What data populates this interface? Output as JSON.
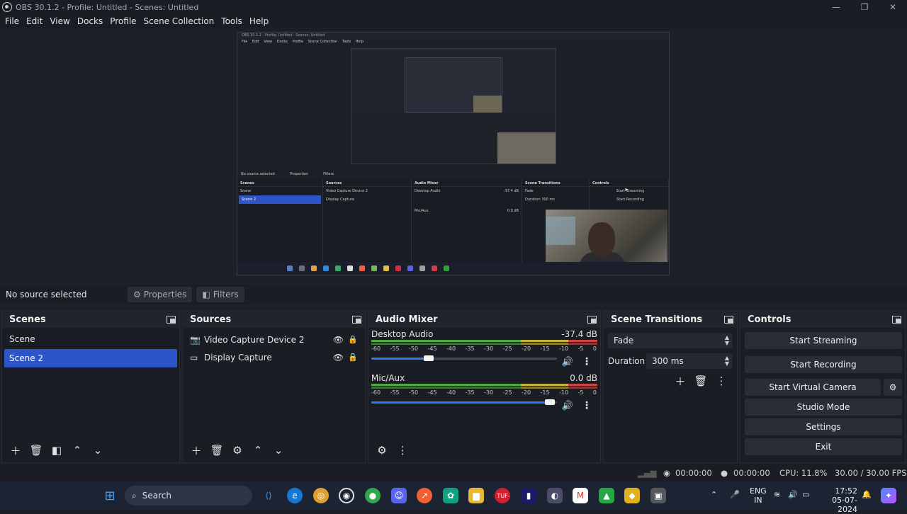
{
  "window": {
    "title": "OBS 30.1.2 - Profile: Untitled - Scenes: Untitled",
    "minimize": "—",
    "maximize": "❐",
    "close": "✕"
  },
  "menu": [
    "File",
    "Edit",
    "View",
    "Docks",
    "Profile",
    "Scene Collection",
    "Tools",
    "Help"
  ],
  "preview": {
    "mini_title": "OBS 30.1.2 - Profile: Untitled - Scenes: Untitled",
    "mini_menu": [
      "File",
      "Edit",
      "View",
      "Docks",
      "Profile",
      "Scene Collection",
      "Tools",
      "Help"
    ],
    "mini_status": "No source selected",
    "mini_properties": "Properties",
    "mini_filters": "Filters",
    "mini_scenes_title": "Scenes",
    "mini_scenes": [
      "Scene",
      "Scene 2"
    ],
    "mini_sources_title": "Sources",
    "mini_sources": [
      "Video Capture Device 2",
      "Display Capture"
    ],
    "mini_mixer_title": "Audio Mixer",
    "mini_desktop": "Desktop Audio",
    "mini_desktop_db": "-37.4 dB",
    "mini_mic": "Mic/Aux",
    "mini_mic_db": "0.0 dB",
    "mini_trans_title": "Scene Transitions",
    "mini_fade": "Fade",
    "mini_duration": "Duration",
    "mini_duration_val": "300 ms",
    "mini_controls_title": "Controls",
    "mini_start_streaming": "Start Streaming",
    "mini_start_recording": "Start Recording",
    "mini_search": "Search"
  },
  "sourcebar": {
    "status": "No source selected",
    "properties": "Properties",
    "filters": "Filters"
  },
  "scenes": {
    "title": "Scenes",
    "items": [
      "Scene",
      "Scene 2"
    ],
    "selected": "Scene 2"
  },
  "sources": {
    "title": "Sources",
    "items": [
      {
        "label": "Video Capture Device 2",
        "icon": "camera-icon"
      },
      {
        "label": "Display Capture",
        "icon": "monitor-icon"
      }
    ]
  },
  "mixer": {
    "title": "Audio Mixer",
    "channels": [
      {
        "name": "Desktop Audio",
        "level": "-37.4 dB",
        "volume": 0.31
      },
      {
        "name": "Mic/Aux",
        "level": "0.0 dB",
        "volume": 0.96
      }
    ],
    "ticks": [
      "-60",
      "-55",
      "-50",
      "-45",
      "-40",
      "-35",
      "-30",
      "-25",
      "-20",
      "-15",
      "-10",
      "-5",
      "0"
    ]
  },
  "transitions": {
    "title": "Scene Transitions",
    "selected": "Fade",
    "duration_label": "Duration",
    "duration_value": "300 ms"
  },
  "controls": {
    "title": "Controls",
    "start_streaming": "Start Streaming",
    "start_recording": "Start Recording",
    "start_virtual_camera": "Start Virtual Camera",
    "studio_mode": "Studio Mode",
    "settings": "Settings",
    "exit": "Exit"
  },
  "status": {
    "stream_time": "00:00:00",
    "record_time": "00:00:00",
    "cpu": "CPU: 11.8%",
    "fps": "30.00 / 30.00 FPS"
  },
  "taskbar": {
    "search_placeholder": "Search",
    "lang_top": "ENG",
    "lang_bottom": "IN",
    "time": "17:52",
    "date": "05-07-2024",
    "tup_label": "TUF"
  },
  "colors": {
    "accent": "#2d55c7",
    "panel": "#1b1d25",
    "background": "#1e2029"
  }
}
